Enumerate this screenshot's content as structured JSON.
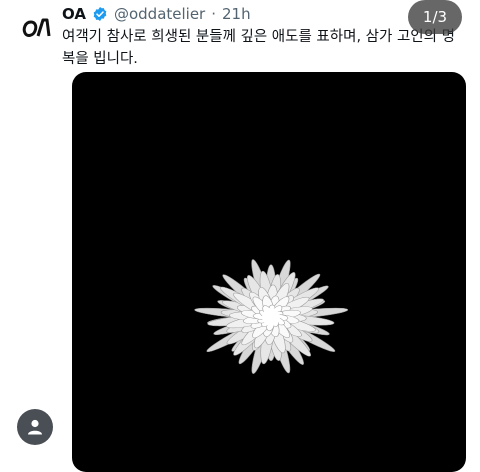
{
  "tweet": {
    "account_logo_text": "OA",
    "display_name": "OA",
    "handle": "@oddatelier",
    "separator": "·",
    "time": "21h",
    "text": "여객기 참사로 희생된 분들께 깊은 애도를 표하며, 삼가 고인의 명복을 빕니다."
  },
  "media": {
    "counter": "1/3",
    "image": "white-chrysanthemum-on-black",
    "background_color": "#000000"
  },
  "icons": {
    "verified": "verified-badge-icon",
    "profile": "profile-icon"
  },
  "colors": {
    "verified_blue": "#1d9bf0",
    "secondary_text": "#536471"
  }
}
